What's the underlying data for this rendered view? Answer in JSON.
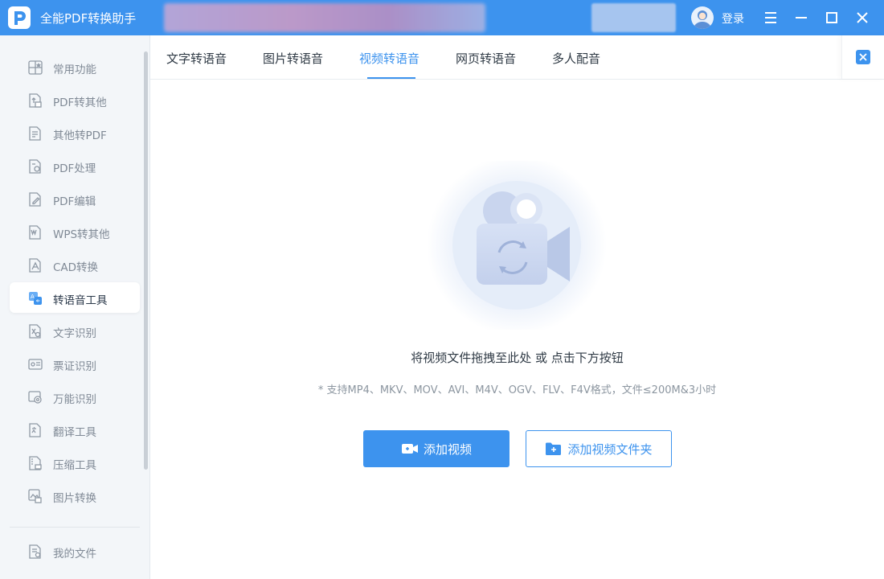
{
  "titlebar": {
    "app_title": "全能PDF转换助手",
    "login_label": "登录"
  },
  "sidebar": {
    "items": [
      {
        "label": "常用功能",
        "icon": "star-grid-icon"
      },
      {
        "label": "PDF转其他",
        "icon": "pdf-convert-icon"
      },
      {
        "label": "其他转PDF",
        "icon": "to-pdf-icon"
      },
      {
        "label": "PDF处理",
        "icon": "pdf-process-icon"
      },
      {
        "label": "PDF编辑",
        "icon": "pdf-edit-icon"
      },
      {
        "label": "WPS转其他",
        "icon": "wps-icon"
      },
      {
        "label": "CAD转换",
        "icon": "cad-icon"
      },
      {
        "label": "转语音工具",
        "icon": "voice-tool-icon"
      },
      {
        "label": "文字识别",
        "icon": "text-ocr-icon"
      },
      {
        "label": "票证识别",
        "icon": "ticket-ocr-icon"
      },
      {
        "label": "万能识别",
        "icon": "universal-ocr-icon"
      },
      {
        "label": "翻译工具",
        "icon": "translate-icon"
      },
      {
        "label": "压缩工具",
        "icon": "compress-icon"
      },
      {
        "label": "图片转换",
        "icon": "image-convert-icon"
      }
    ],
    "active_index": 7,
    "my_files_label": "我的文件"
  },
  "tabs": [
    {
      "label": "文字转语音"
    },
    {
      "label": "图片转语音"
    },
    {
      "label": "视频转语音"
    },
    {
      "label": "网页转语音"
    },
    {
      "label": "多人配音"
    }
  ],
  "active_tab": 2,
  "main": {
    "drop_hint": "将视频文件拖拽至此处 或 点击下方按钮",
    "formats_note": "* 支持MP4、MKV、MOV、AVI、M4V、OGV、FLV、F4V格式，文件≤200M&3小时",
    "add_video_label": "添加视频",
    "add_folder_label": "添加视频文件夹"
  },
  "colors": {
    "accent": "#3d93ee",
    "sidebar_bg": "#f3f6f9"
  }
}
